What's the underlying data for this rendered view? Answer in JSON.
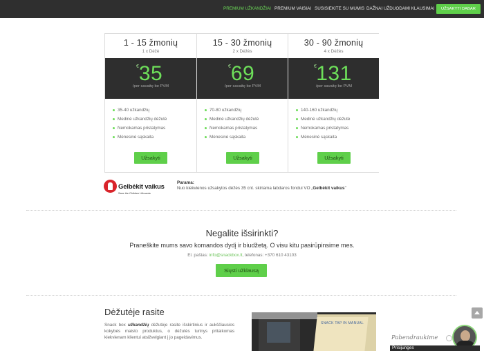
{
  "nav": {
    "items": [
      "PREMIUM UŽKANDŽIAI",
      "PREMIUM VAISIAI",
      "SUSISIEKITE SU MUMIS",
      "DAŽNAI UŽDUODAMI KLAUSIMAI"
    ],
    "cta": "UŽSAKYTI DABAR",
    "active_color": "#6cdc58"
  },
  "plans": [
    {
      "title": "1 - 15 žmonių",
      "sub": "1 x Dėžė",
      "currency": "€",
      "price": "35",
      "per": "/per savaitę be PVM",
      "features": [
        "35-40 užkandžių",
        "Medinė užkandžių dėžutė",
        "Nemokamas pristatymas",
        "Mėnesinė sąskaita"
      ],
      "button": "Užsakyti"
    },
    {
      "title": "15 - 30 žmonių",
      "sub": "2 x Dėžės",
      "currency": "€",
      "price": "69",
      "per": "/per savaitę be PVM",
      "features": [
        "70-80 užkandžių",
        "Medinė užkandžių dėžutė",
        "Nemokamas pristatymas",
        "Mėnesinė sąskaita"
      ],
      "button": "Užsakyti"
    },
    {
      "title": "30 - 90 žmonių",
      "sub": "4 x Dėžės",
      "currency": "€",
      "price": "131",
      "per": "/per savaitę be PVM",
      "features": [
        "140-160 užkandžių",
        "Medinė užkandžių dėžutė",
        "Nemokamas pristatymas",
        "Mėnesinė sąskaita"
      ],
      "button": "Užsakyti"
    }
  ],
  "support": {
    "logo_name": "Gelbėkit vaikus",
    "logo_tag": "Save the Children Lithuania",
    "label": "Parama:",
    "text": "Nuo kiekvienos užsakytos dėžės 35 cnt. skiriama labdaros fondui  VO „",
    "org": "Gelbėkit vaikus",
    "text_end": "\""
  },
  "custom": {
    "title": "Negalite išsirinkti?",
    "subtitle": "Praneškite mums savo komandos dydį ir biudžetą. O visu kitu pasirūpinsime mes.",
    "email_label": "El. paštas: ",
    "email": "info@snackbox.lt",
    "phone": ", telefonas: +370 610 43103",
    "button": "Siųsti užklausą"
  },
  "box": {
    "title": "Dėžutėje rasite",
    "text_start": "Snack box ",
    "text_bold": "užkandžių",
    "text_rest": " dėžutėje rasite išskirtinius ir aukščiausios kokybės maisto produktus, o dėžutės turinys pritaikomas kiekvienam klientui atsižvelgiant į jo pageidavimus.",
    "photo_label": "SNACK TAP IN MANUAL"
  },
  "widgets": {
    "chat_text": "Pabendraukime",
    "chat_bar": "Prisijunges",
    "accent": "#5fcf4a"
  }
}
